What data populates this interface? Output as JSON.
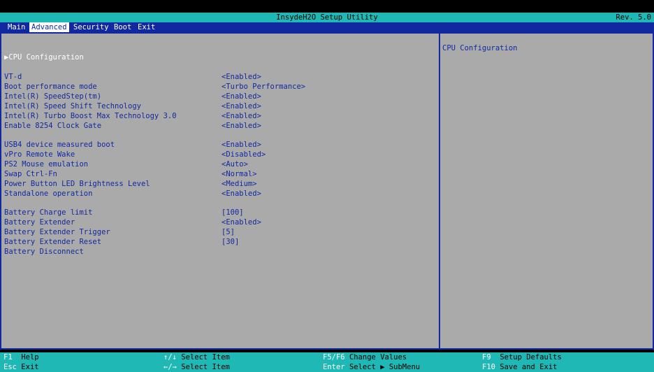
{
  "header": {
    "title": "InsydeH2O Setup Utility",
    "revision": "Rev. 5.0"
  },
  "tabs": [
    "Main",
    "Advanced",
    "Security",
    "Boot",
    "Exit"
  ],
  "active_tab": "Advanced",
  "submenu": "▶CPU Configuration",
  "help_text": "CPU Configuration",
  "settings": [
    {
      "label": "VT-d",
      "value": "<Enabled>"
    },
    {
      "label": "Boot performance mode",
      "value": "<Turbo Performance>"
    },
    {
      "label": "Intel(R) SpeedStep(tm)",
      "value": "<Enabled>"
    },
    {
      "label": "Intel(R) Speed Shift Technology",
      "value": "<Enabled>"
    },
    {
      "label": "Intel(R) Turbo Boost Max Technology 3.0",
      "value": "<Enabled>"
    },
    {
      "label": "Enable 8254 Clock Gate",
      "value": "<Enabled>"
    },
    {
      "label": "USB4 device measured boot",
      "value": "<Enabled>"
    },
    {
      "label": "vPro Remote Wake",
      "value": "<Disabled>"
    },
    {
      "label": "PS2 Mouse emulation",
      "value": "<Auto>"
    },
    {
      "label": "Swap Ctrl-Fn",
      "value": "<Normal>"
    },
    {
      "label": "Power Button LED Brightness Level",
      "value": "<Medium>"
    },
    {
      "label": "Standalone operation",
      "value": "<Enabled>"
    },
    {
      "label": "Battery Charge limit",
      "value": "[100]"
    },
    {
      "label": "Battery Extender",
      "value": "<Enabled>"
    },
    {
      "label": "Battery Extender Trigger",
      "value": "[5]"
    },
    {
      "label": "Battery Extender Reset",
      "value": "[30]"
    },
    {
      "label": "Battery Disconnect",
      "value": ""
    }
  ],
  "status": {
    "f1": {
      "key": "F1",
      "desc": "Help"
    },
    "esc": {
      "key": "Esc",
      "desc": "Exit"
    },
    "updown": {
      "key": "↑/↓",
      "desc": "Select Item"
    },
    "leftright": {
      "key": "←/→",
      "desc": "Select Item"
    },
    "f5f6": {
      "key": "F5/F6",
      "desc": "Change Values"
    },
    "enter": {
      "key": "Enter",
      "desc": "Select ▶ SubMenu"
    },
    "f9": {
      "key": "F9",
      "desc": "Setup Defaults"
    },
    "f10": {
      "key": "F10",
      "desc": "Save and Exit"
    }
  },
  "colors": {
    "teal": "#1fb8b4",
    "blue": "#1228a0",
    "gray": "#aaaaaa",
    "white": "#ffffff",
    "black": "#000000"
  }
}
